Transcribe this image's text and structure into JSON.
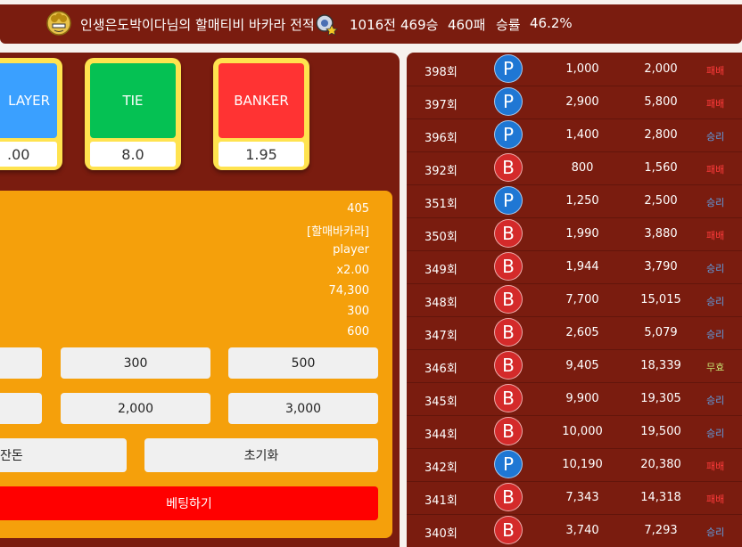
{
  "header": {
    "title": "인생은도박이다님의 할매티비 바카라 전적",
    "total": "1016전",
    "wins": "469승",
    "losses": "460패",
    "rate_label": "승률",
    "rate": "46.2%"
  },
  "bet_cards": [
    {
      "label": "LAYER",
      "odds": ".00",
      "color": "#3aa0ff"
    },
    {
      "label": "TIE",
      "odds": "8.0",
      "color": "#05c153"
    },
    {
      "label": "BANKER",
      "odds": "1.95",
      "color": "#ff3333"
    }
  ],
  "slip": {
    "lines": [
      "405",
      "[할매바카라]",
      "player",
      "x2.00",
      "74,300",
      "300",
      "600"
    ]
  },
  "chips": {
    "row1": [
      "300",
      "500"
    ],
    "row2": [
      "2,000",
      "3,000"
    ]
  },
  "actions": {
    "all_in": "잔돈",
    "reset": "초기화",
    "bet": "베팅하기"
  },
  "history": [
    {
      "round": "398회",
      "pick": "P",
      "bet": "1,000",
      "payout": "2,000",
      "result": "패배"
    },
    {
      "round": "397회",
      "pick": "P",
      "bet": "2,900",
      "payout": "5,800",
      "result": "패배"
    },
    {
      "round": "396회",
      "pick": "P",
      "bet": "1,400",
      "payout": "2,800",
      "result": "승리"
    },
    {
      "round": "392회",
      "pick": "B",
      "bet": "800",
      "payout": "1,560",
      "result": "패배"
    },
    {
      "round": "351회",
      "pick": "P",
      "bet": "1,250",
      "payout": "2,500",
      "result": "승리"
    },
    {
      "round": "350회",
      "pick": "B",
      "bet": "1,990",
      "payout": "3,880",
      "result": "패배"
    },
    {
      "round": "349회",
      "pick": "B",
      "bet": "1,944",
      "payout": "3,790",
      "result": "승리"
    },
    {
      "round": "348회",
      "pick": "B",
      "bet": "7,700",
      "payout": "15,015",
      "result": "승리"
    },
    {
      "round": "347회",
      "pick": "B",
      "bet": "2,605",
      "payout": "5,079",
      "result": "승리"
    },
    {
      "round": "346회",
      "pick": "B",
      "bet": "9,405",
      "payout": "18,339",
      "result": "무효"
    },
    {
      "round": "345회",
      "pick": "B",
      "bet": "9,900",
      "payout": "19,305",
      "result": "승리"
    },
    {
      "round": "344회",
      "pick": "B",
      "bet": "10,000",
      "payout": "19,500",
      "result": "승리"
    },
    {
      "round": "342회",
      "pick": "P",
      "bet": "10,190",
      "payout": "20,380",
      "result": "패배"
    },
    {
      "round": "341회",
      "pick": "B",
      "bet": "7,343",
      "payout": "14,318",
      "result": "패배"
    },
    {
      "round": "340회",
      "pick": "B",
      "bet": "3,740",
      "payout": "7,293",
      "result": "승리"
    }
  ],
  "colors": {
    "player": "#1f77d4",
    "banker": "#d42a2a",
    "lose": "#ff3b3b",
    "win": "#5fa0e6",
    "void": "#c6e070"
  }
}
